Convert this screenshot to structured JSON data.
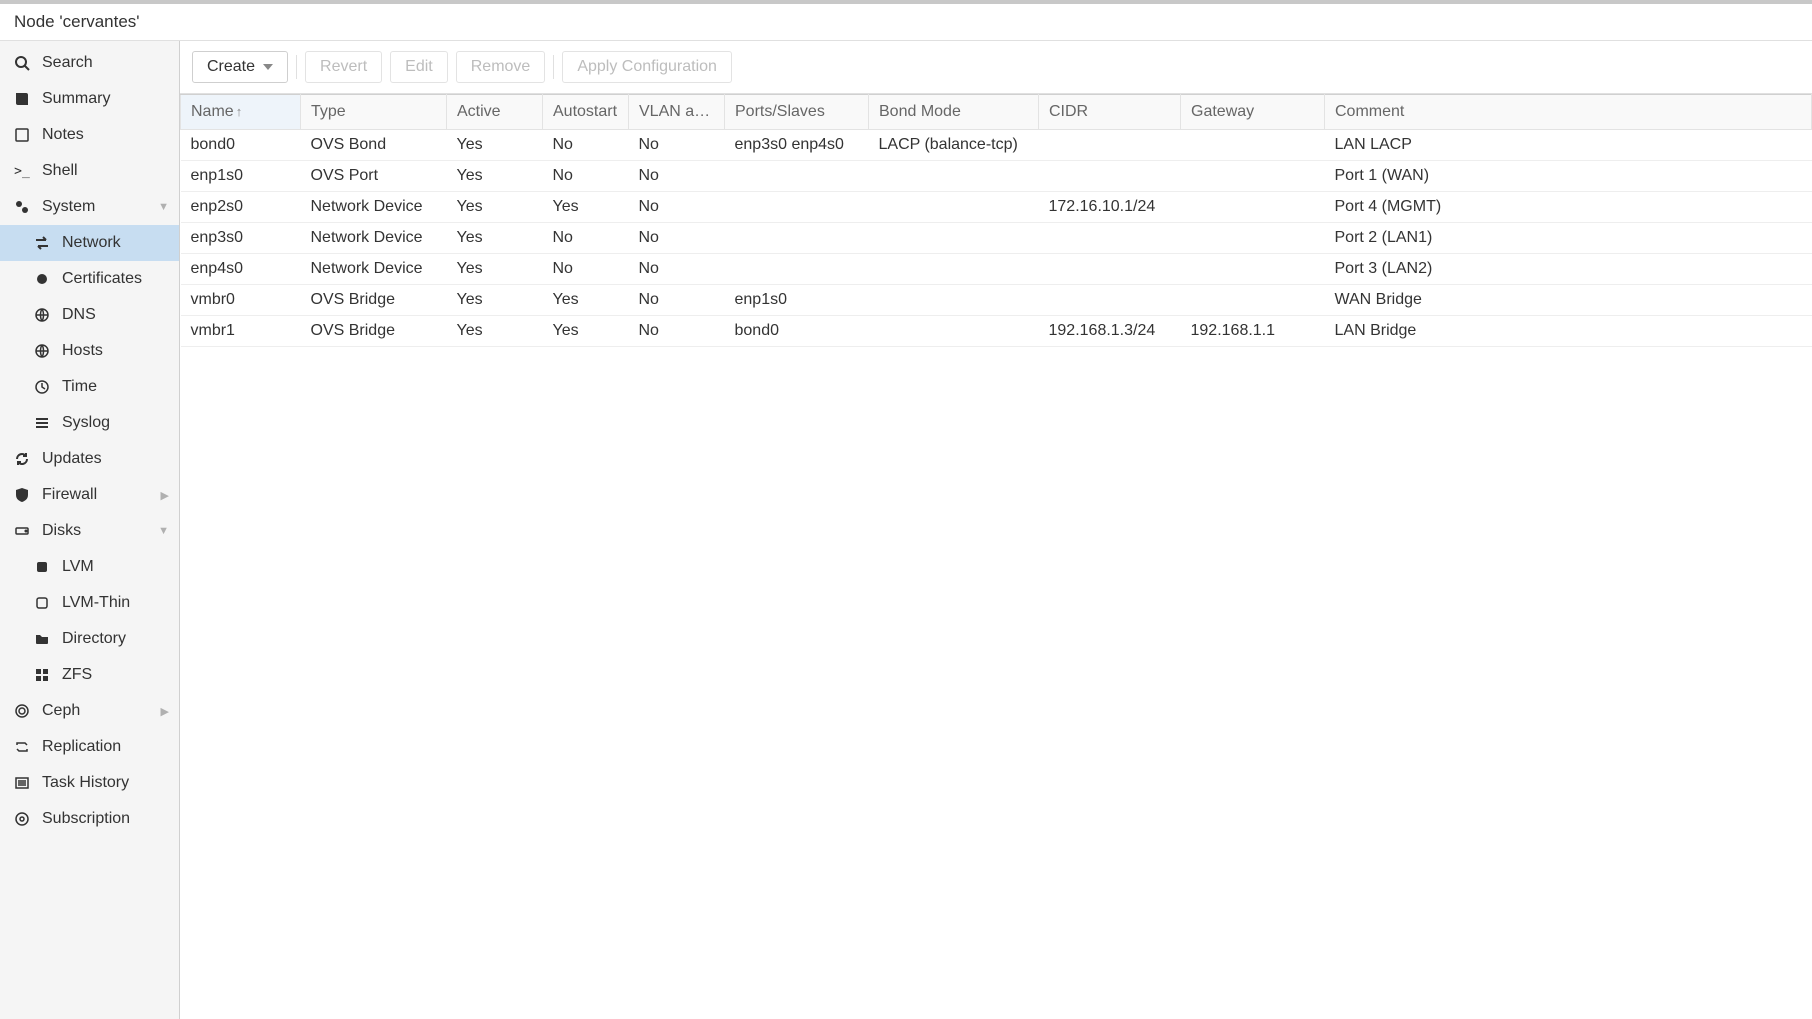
{
  "title": "Node 'cervantes'",
  "sidebar": {
    "items": [
      {
        "label": "Search"
      },
      {
        "label": "Summary"
      },
      {
        "label": "Notes"
      },
      {
        "label": "Shell"
      },
      {
        "label": "System"
      },
      {
        "label": "Network"
      },
      {
        "label": "Certificates"
      },
      {
        "label": "DNS"
      },
      {
        "label": "Hosts"
      },
      {
        "label": "Time"
      },
      {
        "label": "Syslog"
      },
      {
        "label": "Updates"
      },
      {
        "label": "Firewall"
      },
      {
        "label": "Disks"
      },
      {
        "label": "LVM"
      },
      {
        "label": "LVM-Thin"
      },
      {
        "label": "Directory"
      },
      {
        "label": "ZFS"
      },
      {
        "label": "Ceph"
      },
      {
        "label": "Replication"
      },
      {
        "label": "Task History"
      },
      {
        "label": "Subscription"
      }
    ]
  },
  "toolbar": {
    "create": "Create",
    "revert": "Revert",
    "edit": "Edit",
    "remove": "Remove",
    "apply": "Apply Configuration"
  },
  "table": {
    "columns": {
      "name": "Name",
      "type": "Type",
      "active": "Active",
      "autostart": "Autostart",
      "vlan": "VLAN a…",
      "ports": "Ports/Slaves",
      "bond": "Bond Mode",
      "cidr": "CIDR",
      "gateway": "Gateway",
      "comment": "Comment"
    },
    "rows": [
      {
        "name": "bond0",
        "type": "OVS Bond",
        "active": "Yes",
        "autostart": "No",
        "vlan": "No",
        "ports": "enp3s0 enp4s0",
        "bond": "LACP (balance-tcp)",
        "cidr": "",
        "gateway": "",
        "comment": "LAN LACP"
      },
      {
        "name": "enp1s0",
        "type": "OVS Port",
        "active": "Yes",
        "autostart": "No",
        "vlan": "No",
        "ports": "",
        "bond": "",
        "cidr": "",
        "gateway": "",
        "comment": "Port 1 (WAN)"
      },
      {
        "name": "enp2s0",
        "type": "Network Device",
        "active": "Yes",
        "autostart": "Yes",
        "vlan": "No",
        "ports": "",
        "bond": "",
        "cidr": "172.16.10.1/24",
        "gateway": "",
        "comment": "Port 4 (MGMT)"
      },
      {
        "name": "enp3s0",
        "type": "Network Device",
        "active": "Yes",
        "autostart": "No",
        "vlan": "No",
        "ports": "",
        "bond": "",
        "cidr": "",
        "gateway": "",
        "comment": "Port 2 (LAN1)"
      },
      {
        "name": "enp4s0",
        "type": "Network Device",
        "active": "Yes",
        "autostart": "No",
        "vlan": "No",
        "ports": "",
        "bond": "",
        "cidr": "",
        "gateway": "",
        "comment": "Port 3 (LAN2)"
      },
      {
        "name": "vmbr0",
        "type": "OVS Bridge",
        "active": "Yes",
        "autostart": "Yes",
        "vlan": "No",
        "ports": "enp1s0",
        "bond": "",
        "cidr": "",
        "gateway": "",
        "comment": "WAN Bridge"
      },
      {
        "name": "vmbr1",
        "type": "OVS Bridge",
        "active": "Yes",
        "autostart": "Yes",
        "vlan": "No",
        "ports": "bond0",
        "bond": "",
        "cidr": "192.168.1.3/24",
        "gateway": "192.168.1.1",
        "comment": "LAN Bridge"
      }
    ]
  }
}
